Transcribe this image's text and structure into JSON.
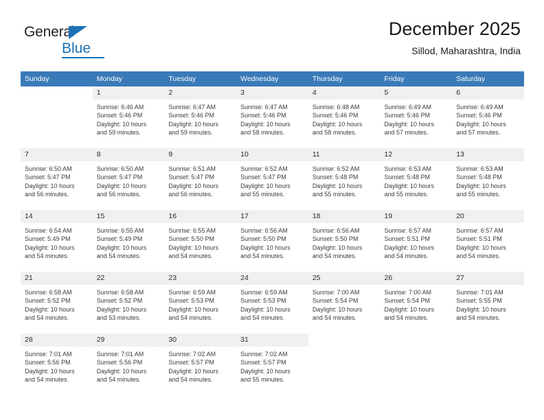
{
  "logo": {
    "word_one": "General",
    "word_two": "Blue",
    "triangle_icon": "triangle-icon",
    "brand_color": "#1b72b8"
  },
  "header": {
    "title": "December 2025",
    "subtitle": "Sillod, Maharashtra, India"
  },
  "theme": {
    "header_bg": "#3a7ab8",
    "daynum_bg": "#f0f0f0",
    "row_divider": "#3a7ab8",
    "text": "#3a3a3a"
  },
  "calendar": {
    "weekday_headers": [
      "Sunday",
      "Monday",
      "Tuesday",
      "Wednesday",
      "Thursday",
      "Friday",
      "Saturday"
    ],
    "weeks": [
      [
        {
          "day": "",
          "lines": []
        },
        {
          "day": "1",
          "lines": [
            "Sunrise: 6:46 AM",
            "Sunset: 5:46 PM",
            "Daylight: 10 hours",
            "and 59 minutes."
          ]
        },
        {
          "day": "2",
          "lines": [
            "Sunrise: 6:47 AM",
            "Sunset: 5:46 PM",
            "Daylight: 10 hours",
            "and 59 minutes."
          ]
        },
        {
          "day": "3",
          "lines": [
            "Sunrise: 6:47 AM",
            "Sunset: 5:46 PM",
            "Daylight: 10 hours",
            "and 58 minutes."
          ]
        },
        {
          "day": "4",
          "lines": [
            "Sunrise: 6:48 AM",
            "Sunset: 5:46 PM",
            "Daylight: 10 hours",
            "and 58 minutes."
          ]
        },
        {
          "day": "5",
          "lines": [
            "Sunrise: 6:49 AM",
            "Sunset: 5:46 PM",
            "Daylight: 10 hours",
            "and 57 minutes."
          ]
        },
        {
          "day": "6",
          "lines": [
            "Sunrise: 6:49 AM",
            "Sunset: 5:46 PM",
            "Daylight: 10 hours",
            "and 57 minutes."
          ]
        }
      ],
      [
        {
          "day": "7",
          "lines": [
            "Sunrise: 6:50 AM",
            "Sunset: 5:47 PM",
            "Daylight: 10 hours",
            "and 56 minutes."
          ]
        },
        {
          "day": "8",
          "lines": [
            "Sunrise: 6:50 AM",
            "Sunset: 5:47 PM",
            "Daylight: 10 hours",
            "and 56 minutes."
          ]
        },
        {
          "day": "9",
          "lines": [
            "Sunrise: 6:51 AM",
            "Sunset: 5:47 PM",
            "Daylight: 10 hours",
            "and 56 minutes."
          ]
        },
        {
          "day": "10",
          "lines": [
            "Sunrise: 6:52 AM",
            "Sunset: 5:47 PM",
            "Daylight: 10 hours",
            "and 55 minutes."
          ]
        },
        {
          "day": "11",
          "lines": [
            "Sunrise: 6:52 AM",
            "Sunset: 5:48 PM",
            "Daylight: 10 hours",
            "and 55 minutes."
          ]
        },
        {
          "day": "12",
          "lines": [
            "Sunrise: 6:53 AM",
            "Sunset: 5:48 PM",
            "Daylight: 10 hours",
            "and 55 minutes."
          ]
        },
        {
          "day": "13",
          "lines": [
            "Sunrise: 6:53 AM",
            "Sunset: 5:48 PM",
            "Daylight: 10 hours",
            "and 55 minutes."
          ]
        }
      ],
      [
        {
          "day": "14",
          "lines": [
            "Sunrise: 6:54 AM",
            "Sunset: 5:49 PM",
            "Daylight: 10 hours",
            "and 54 minutes."
          ]
        },
        {
          "day": "15",
          "lines": [
            "Sunrise: 6:55 AM",
            "Sunset: 5:49 PM",
            "Daylight: 10 hours",
            "and 54 minutes."
          ]
        },
        {
          "day": "16",
          "lines": [
            "Sunrise: 6:55 AM",
            "Sunset: 5:50 PM",
            "Daylight: 10 hours",
            "and 54 minutes."
          ]
        },
        {
          "day": "17",
          "lines": [
            "Sunrise: 6:56 AM",
            "Sunset: 5:50 PM",
            "Daylight: 10 hours",
            "and 54 minutes."
          ]
        },
        {
          "day": "18",
          "lines": [
            "Sunrise: 6:56 AM",
            "Sunset: 5:50 PM",
            "Daylight: 10 hours",
            "and 54 minutes."
          ]
        },
        {
          "day": "19",
          "lines": [
            "Sunrise: 6:57 AM",
            "Sunset: 5:51 PM",
            "Daylight: 10 hours",
            "and 54 minutes."
          ]
        },
        {
          "day": "20",
          "lines": [
            "Sunrise: 6:57 AM",
            "Sunset: 5:51 PM",
            "Daylight: 10 hours",
            "and 54 minutes."
          ]
        }
      ],
      [
        {
          "day": "21",
          "lines": [
            "Sunrise: 6:58 AM",
            "Sunset: 5:52 PM",
            "Daylight: 10 hours",
            "and 54 minutes."
          ]
        },
        {
          "day": "22",
          "lines": [
            "Sunrise: 6:58 AM",
            "Sunset: 5:52 PM",
            "Daylight: 10 hours",
            "and 53 minutes."
          ]
        },
        {
          "day": "23",
          "lines": [
            "Sunrise: 6:59 AM",
            "Sunset: 5:53 PM",
            "Daylight: 10 hours",
            "and 54 minutes."
          ]
        },
        {
          "day": "24",
          "lines": [
            "Sunrise: 6:59 AM",
            "Sunset: 5:53 PM",
            "Daylight: 10 hours",
            "and 54 minutes."
          ]
        },
        {
          "day": "25",
          "lines": [
            "Sunrise: 7:00 AM",
            "Sunset: 5:54 PM",
            "Daylight: 10 hours",
            "and 54 minutes."
          ]
        },
        {
          "day": "26",
          "lines": [
            "Sunrise: 7:00 AM",
            "Sunset: 5:54 PM",
            "Daylight: 10 hours",
            "and 54 minutes."
          ]
        },
        {
          "day": "27",
          "lines": [
            "Sunrise: 7:01 AM",
            "Sunset: 5:55 PM",
            "Daylight: 10 hours",
            "and 54 minutes."
          ]
        }
      ],
      [
        {
          "day": "28",
          "lines": [
            "Sunrise: 7:01 AM",
            "Sunset: 5:56 PM",
            "Daylight: 10 hours",
            "and 54 minutes."
          ]
        },
        {
          "day": "29",
          "lines": [
            "Sunrise: 7:01 AM",
            "Sunset: 5:56 PM",
            "Daylight: 10 hours",
            "and 54 minutes."
          ]
        },
        {
          "day": "30",
          "lines": [
            "Sunrise: 7:02 AM",
            "Sunset: 5:57 PM",
            "Daylight: 10 hours",
            "and 54 minutes."
          ]
        },
        {
          "day": "31",
          "lines": [
            "Sunrise: 7:02 AM",
            "Sunset: 5:57 PM",
            "Daylight: 10 hours",
            "and 55 minutes."
          ]
        },
        {
          "day": "",
          "lines": []
        },
        {
          "day": "",
          "lines": []
        },
        {
          "day": "",
          "lines": []
        }
      ]
    ]
  }
}
